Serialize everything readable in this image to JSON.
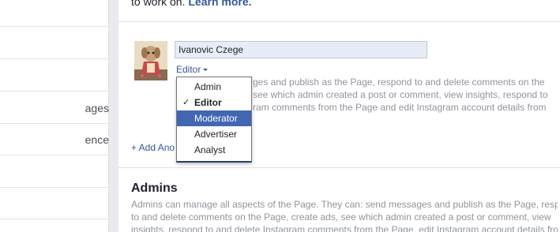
{
  "sidebar": {
    "items": [
      {
        "label": ""
      },
      {
        "label": ""
      },
      {
        "label": ""
      },
      {
        "label": "ages"
      },
      {
        "label": "ence"
      },
      {
        "label": ""
      },
      {
        "label": ""
      }
    ]
  },
  "intro": {
    "text": "to work on.",
    "link": "Learn more."
  },
  "assign": {
    "name_value": "Ivanovic Czege",
    "role_label": "Editor",
    "role_desc_lines": [
      "ges and publish as the Page, respond to and delete comments on the",
      "see which admin created a post or comment, view insights, respond to",
      "ram comments from the Page and edit Instagram account details from"
    ],
    "add_another": "+ Add Ano"
  },
  "role_menu": {
    "items": [
      {
        "label": "Admin",
        "checked": false,
        "highlighted": false
      },
      {
        "label": "Editor",
        "checked": true,
        "highlighted": false
      },
      {
        "label": "Moderator",
        "checked": false,
        "highlighted": true
      },
      {
        "label": "Advertiser",
        "checked": false,
        "highlighted": false
      },
      {
        "label": "Analyst",
        "checked": false,
        "highlighted": false
      }
    ],
    "check_glyph": "✓"
  },
  "admins": {
    "title": "Admins",
    "desc_lines": [
      "Admins can manage all aspects of the Page. They can: send messages and publish as the Page, respond",
      "to and delete comments on the Page, create ads, see which admin created a post or comment, view",
      "insights, respond to and delete Instagram comments from the Page, edit Instagram account details from"
    ]
  },
  "colors": {
    "link": "#365899",
    "highlight": "#4267b2",
    "muted": "#90949c"
  },
  "icons": {
    "avatar": "profile-photo",
    "caret": "caret-down-icon",
    "check": "check-icon"
  }
}
